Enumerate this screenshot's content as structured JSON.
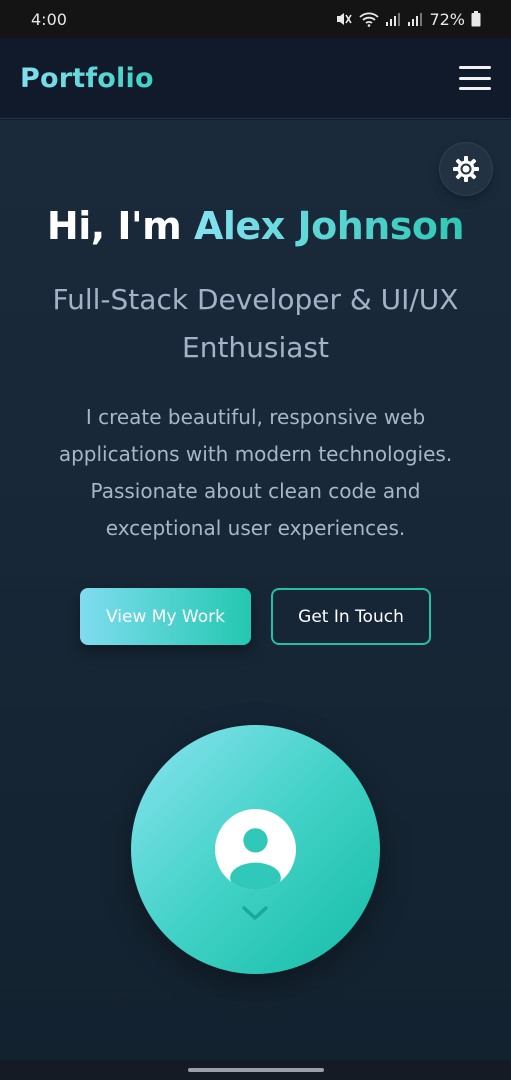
{
  "status_bar": {
    "time": "4:00",
    "battery": "72%",
    "icons": [
      "mute-icon",
      "wifi-icon",
      "signal-icon",
      "signal-icon",
      "battery-icon"
    ]
  },
  "nav": {
    "brand": "Portfolio",
    "menu_icon": "hamburger-menu-icon"
  },
  "hero": {
    "theme_toggle_icon": "gear-sun-icon",
    "greeting": "Hi, I'm ",
    "name": "Alex Johnson",
    "subtitle": "Full-Stack Developer & UI/UX Enthusiast",
    "description": "I create beautiful, responsive web applications with modern technologies. Passionate about clean code and exceptional user experiences.",
    "primary_button": "View My Work",
    "secondary_button": "Get In Touch",
    "avatar_icon": "user-avatar-icon",
    "scroll_icon": "chevron-down-icon"
  },
  "colors": {
    "accent_start": "#84dff0",
    "accent_end": "#23c8b0",
    "background": "#172737",
    "nav_background": "#111a2b"
  }
}
